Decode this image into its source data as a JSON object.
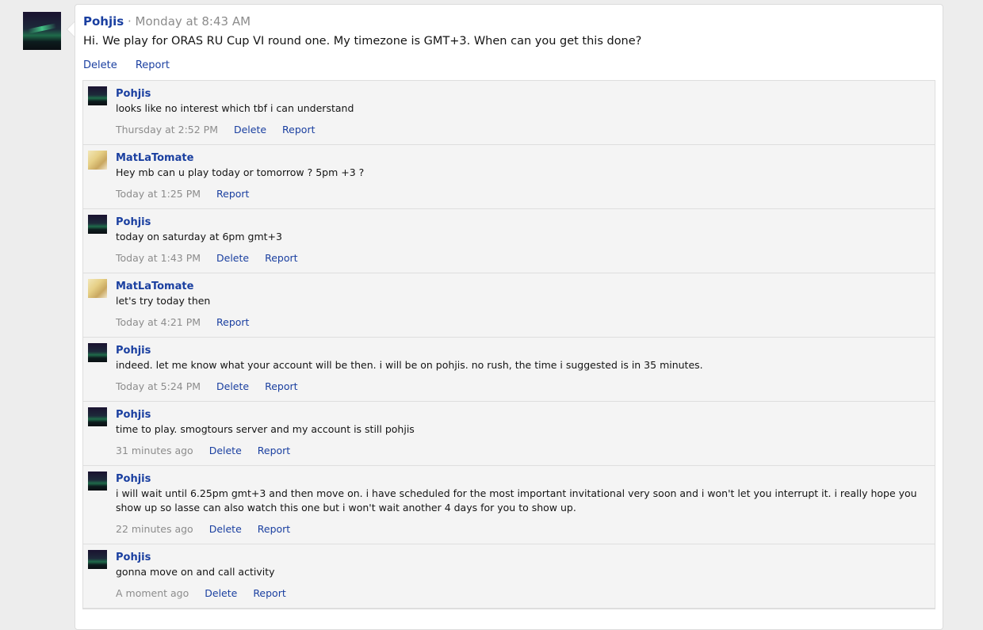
{
  "post": {
    "author": "Pohjis",
    "separator": "·",
    "time": "Monday at 8:43 AM",
    "text": "Hi. We play for ORAS RU Cup VI round one. My timezone is GMT+3. When can you get this done?",
    "actions": [
      "Delete",
      "Report"
    ]
  },
  "comments": [
    {
      "user": "Pohjis",
      "avatar": "aurora-avatar",
      "text": "looks like no interest which tbf i can understand",
      "time": "Thursday at 2:52 PM",
      "actions": [
        "Delete",
        "Report"
      ]
    },
    {
      "user": "MatLaTomate",
      "avatar": "pokemon-avatar",
      "text": "Hey mb can u play today or tomorrow ? 5pm +3 ?",
      "time": "Today at 1:25 PM",
      "actions": [
        "Report"
      ]
    },
    {
      "user": "Pohjis",
      "avatar": "aurora-avatar",
      "text": "today on saturday at 6pm gmt+3",
      "time": "Today at 1:43 PM",
      "actions": [
        "Delete",
        "Report"
      ]
    },
    {
      "user": "MatLaTomate",
      "avatar": "pokemon-avatar",
      "text": "let's try today then",
      "time": "Today at 4:21 PM",
      "actions": [
        "Report"
      ]
    },
    {
      "user": "Pohjis",
      "avatar": "aurora-avatar",
      "text": "indeed. let me know what your account will be then. i will be on pohjis. no rush, the time i suggested is in 35 minutes.",
      "time": "Today at 5:24 PM",
      "actions": [
        "Delete",
        "Report"
      ]
    },
    {
      "user": "Pohjis",
      "avatar": "aurora-avatar",
      "text": "time to play. smogtours server and my account is still pohjis",
      "time": "31 minutes ago",
      "actions": [
        "Delete",
        "Report"
      ]
    },
    {
      "user": "Pohjis",
      "avatar": "aurora-avatar",
      "text": "i will wait until 6.25pm gmt+3 and then move on. i have scheduled for the most important invitational very soon and i won't let you interrupt it. i really hope you show up so lasse can also watch this one but i won't wait another 4 days for you to show up.",
      "time": "22 minutes ago",
      "actions": [
        "Delete",
        "Report"
      ]
    },
    {
      "user": "Pohjis",
      "avatar": "aurora-avatar",
      "text": "gonna move on and call activity",
      "time": "A moment ago",
      "actions": [
        "Delete",
        "Report"
      ]
    }
  ]
}
